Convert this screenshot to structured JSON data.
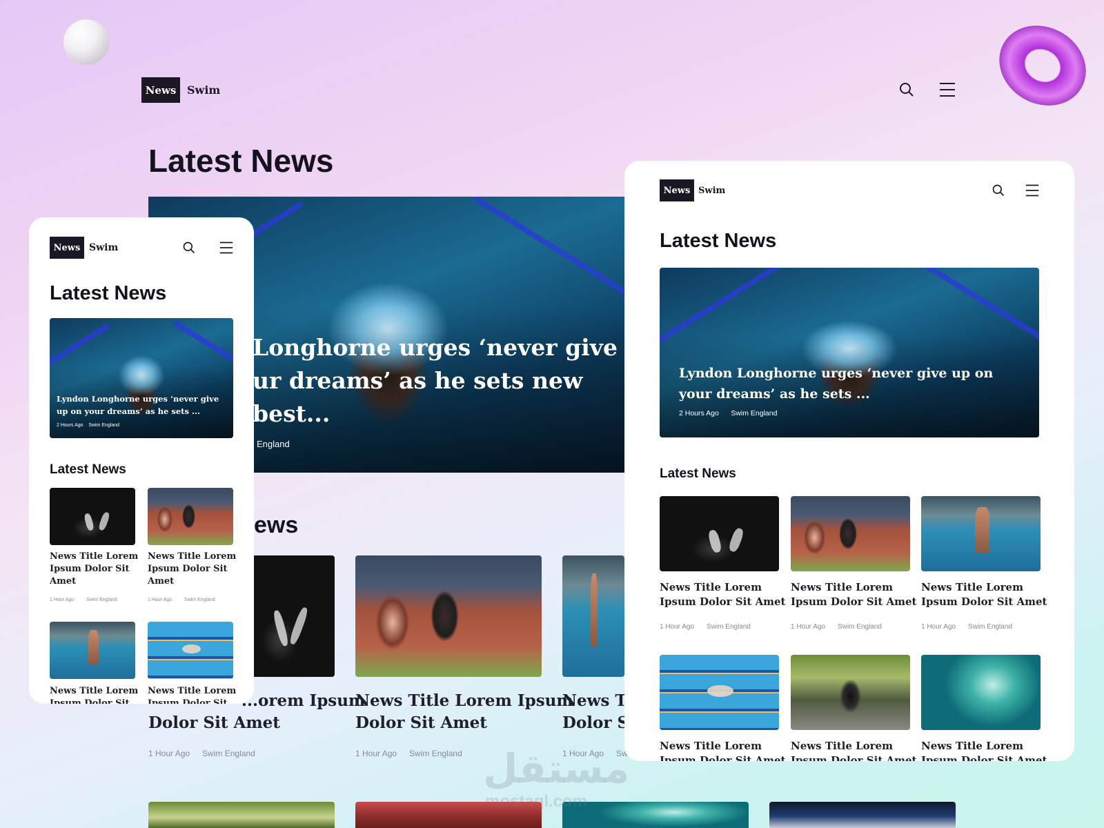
{
  "brand": {
    "box": "News",
    "word": "Swim"
  },
  "section_title": "Latest News",
  "subsection_title": "Latest News",
  "hero": {
    "title": "Lyndon Longhorne urges ‘never give up on your dreams’ as he sets new best...",
    "title_short": "Lyndon Longhorne urges ‘never give up on your dreams’ as he sets ...",
    "time": "2 Hours Ago",
    "source": "Swim England"
  },
  "desktop_hero_partial": {
    "line1": "Longhorne urges ‘never give",
    "line2": "ur dreams’ as he sets new",
    "line3": "best...",
    "source_tail": "England"
  },
  "desktop_bg": {
    "sub_heading_tail": "ews",
    "cards": [
      {
        "title": "News Title Lorem Ipsum Dolor Sit Amet",
        "title_visible": "...orem Ipsum",
        "title_line2": "Dolor Sit Amet",
        "time": "1 Hour Ago",
        "source": "Swim England"
      },
      {
        "title": "News Title Lorem Ipsum Dolor Sit Amet",
        "title_line1": "News Title Lorem Ipsum",
        "title_line2": "Dolor Sit Amet",
        "time": "1 Hour Ago",
        "source": "Swim England"
      },
      {
        "title_line1": "News Tit",
        "title_line2": "Dolor Si",
        "time": "1 Hour Ago",
        "source": "Sw"
      }
    ]
  },
  "news_items": [
    {
      "title_line1": "News Title Lorem",
      "title_line2": "Ipsum Dolor Sit Amet",
      "time": "1 Hour Ago",
      "source": "Swim England",
      "image": "fencing"
    },
    {
      "title_line1": "News Title Lorem",
      "title_line2": "Ipsum Dolor Sit Amet",
      "time": "1 Hour Ago",
      "source": "Swim England",
      "image": "track"
    },
    {
      "title_line1": "News Title Lorem",
      "title_line2": "Ipsum Dolor Sit Amet",
      "time": "1 Hour Ago",
      "source": "Swim England",
      "image": "pool"
    },
    {
      "title_line1": "News Title Lorem",
      "title_line2": "Ipsum Dolor Sit Amet",
      "image": "lane-swimmer"
    },
    {
      "title_line1": "News Title Lorem",
      "title_line2": "Ipsum Dolor Sit Amet",
      "image": "cyclist"
    },
    {
      "title_line1": "News Title Lorem",
      "title_line2": "Ipsum Dolor Sit Amet",
      "image": "surf"
    }
  ],
  "mobile_items": [
    {
      "l1": "News Title Lorem",
      "l2": "Ipsum Dolor Sit",
      "l3": "Amet",
      "time": "1 Hour Ago",
      "source": "Swim England"
    },
    {
      "l1": "News Title Lorem",
      "l2": "Ipsum Dolor Sit",
      "l3": "Amet",
      "time": "1 Hour Ago",
      "source": "Swim England"
    },
    {
      "l1": "News Title Lorem",
      "l2": "Ipsum Dolor Sit"
    },
    {
      "l1": "News Title Lorem",
      "l2": "Ipsum Dolor Sit"
    }
  ],
  "watermark": {
    "arabic": "مستقل",
    "latin": "mostaql.com"
  },
  "icons": [
    "search-icon",
    "menu-icon"
  ],
  "colors": {
    "brand_dark": "#1b1823",
    "text": "#14121c",
    "meta": "#8a8894"
  }
}
